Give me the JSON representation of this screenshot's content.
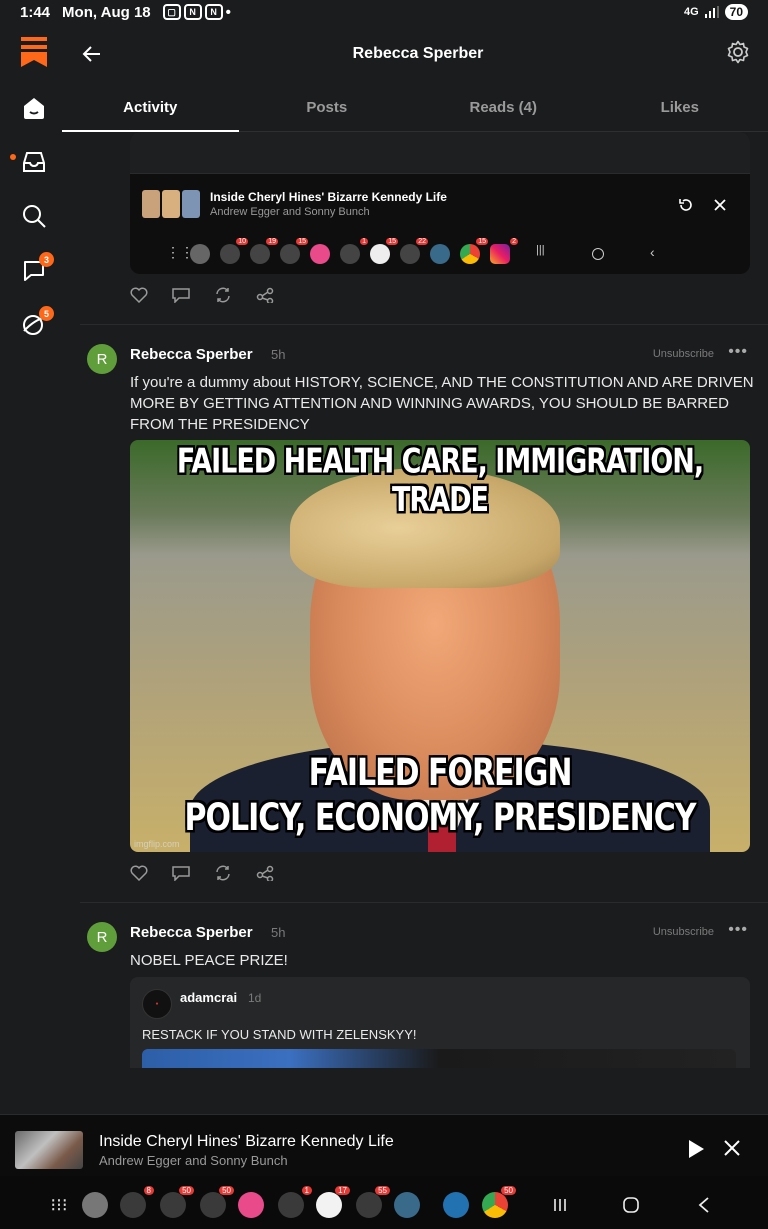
{
  "status": {
    "time": "1:44",
    "date": "Mon, Aug 18",
    "network": "4G",
    "battery": "70"
  },
  "header": {
    "title": "Rebecca Sperber"
  },
  "tabs": [
    {
      "label": "Activity"
    },
    {
      "label": "Posts"
    },
    {
      "label": "Reads (4)"
    },
    {
      "label": "Likes"
    }
  ],
  "rail": {
    "chat_badge": "3",
    "activity_badge": "5"
  },
  "embed": {
    "mini_player_title": "Inside Cheryl Hines' Bizarre Kennedy Life",
    "mini_player_sub": "Andrew Egger and Sonny Bunch",
    "dock_badges": [
      "10",
      "19",
      "15",
      "1",
      "15",
      "22",
      "15",
      "2"
    ]
  },
  "posts": [
    {
      "avatar_letter": "R",
      "author": "Rebecca Sperber",
      "ago": "5h",
      "unsubscribe": "Unsubscribe",
      "text": "If you're a dummy about HISTORY, SCIENCE, AND THE CONSTITUTION AND ARE DRIVEN MORE BY GETTING ATTENTION AND WINNING AWARDS, YOU SHOULD BE BARRED FROM THE PRESIDENCY",
      "meme_top": "FAILED HEALTH CARE, IMMIGRATION, TRADE",
      "meme_bottom_1": "FAILED FOREIGN",
      "meme_bottom_2": "POLICY, ECONOMY, PRESIDENCY",
      "watermark": "imgflip.com"
    },
    {
      "avatar_letter": "R",
      "author": "Rebecca Sperber",
      "ago": "5h",
      "unsubscribe": "Unsubscribe",
      "text": "NOBEL PEACE PRIZE!",
      "quote": {
        "author": "adamcrai",
        "ago": "1d",
        "text": "RESTACK IF YOU STAND WITH ZELENSKYY!"
      }
    }
  ],
  "player": {
    "title": "Inside Cheryl Hines' Bizarre Kennedy Life",
    "subtitle": "Andrew Egger and Sonny Bunch"
  },
  "taskbar": {
    "badges": [
      "8",
      "50",
      "50",
      "1",
      "17",
      "55",
      "50"
    ]
  }
}
